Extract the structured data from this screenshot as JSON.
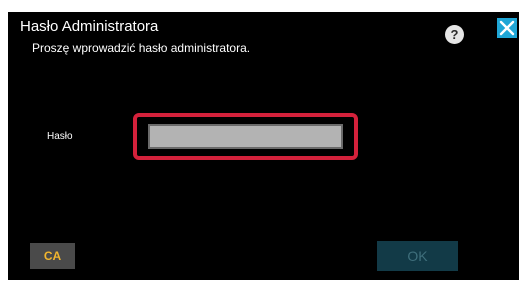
{
  "dialog": {
    "title": "Hasło Administratora",
    "subtitle": "Proszę wprowadzić hasło administratora."
  },
  "header": {
    "help_label": "?",
    "help_icon": "question-mark-icon",
    "close_icon": "close-icon"
  },
  "form": {
    "password_label": "Hasło",
    "password_value": "",
    "password_placeholder": ""
  },
  "buttons": {
    "ca_label": "CA",
    "ok_label": "OK",
    "ok_enabled": false
  },
  "colors": {
    "background": "#000000",
    "highlight_border": "#d4213b",
    "close_button": "#1fa6d6",
    "ca_text": "#f2b62e",
    "ok_button": "#123a47",
    "input_fill": "#b3b3b3"
  }
}
